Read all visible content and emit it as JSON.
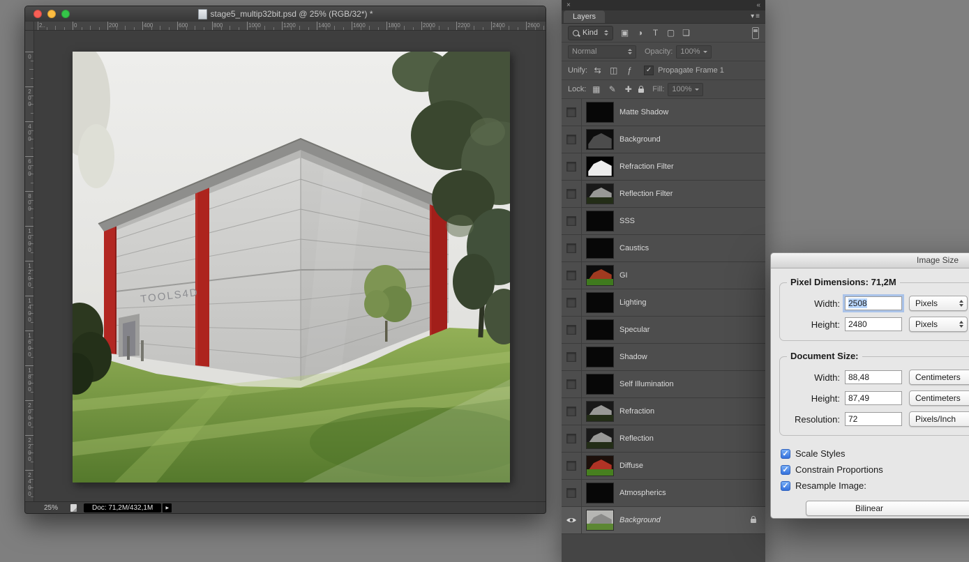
{
  "window": {
    "title": "stage5_multip32bit.psd @ 25% (RGB/32*) *",
    "zoom_level": "25%",
    "doc_info": "Doc: 71,2M/432,1M",
    "sign_text": "TOOLS4D",
    "ruler_top_labels": [
      "2..",
      "0",
      "200",
      "400",
      "600",
      "800",
      "1000",
      "1200",
      "1400",
      "1600",
      "1800",
      "2000",
      "2200",
      "2400",
      "2600"
    ],
    "ruler_left_labels": [
      "0",
      "200",
      "400",
      "600",
      "800",
      "1000",
      "1200",
      "1400",
      "1600",
      "1800",
      "2000",
      "2200",
      "2400"
    ]
  },
  "layers_panel": {
    "tab_label": "Layers",
    "kind_label": "Kind",
    "blend_mode": "Normal",
    "opacity_label": "Opacity:",
    "opacity_value": "100%",
    "unify_label": "Unify:",
    "propagate_label": "Propagate Frame 1",
    "propagate_checked": true,
    "lock_label": "Lock:",
    "fill_label": "Fill:",
    "fill_value": "100%",
    "filter_icons": [
      {
        "name": "pixel-layer-filter-icon",
        "glyph": "▣"
      },
      {
        "name": "adjustment-layer-filter-icon",
        "glyph": "◑"
      },
      {
        "name": "type-layer-filter-icon",
        "glyph": "T"
      },
      {
        "name": "shape-layer-filter-icon",
        "glyph": "▢"
      },
      {
        "name": "smart-object-filter-icon",
        "glyph": "❏"
      }
    ],
    "unify_icons": [
      {
        "name": "unify-position-icon",
        "glyph": "⇆"
      },
      {
        "name": "unify-visibility-icon",
        "glyph": "◫"
      },
      {
        "name": "unify-style-icon",
        "glyph": "ƒ"
      }
    ],
    "lock_icons": [
      {
        "name": "lock-transparency-icon",
        "glyph": "▦"
      },
      {
        "name": "lock-pixels-icon",
        "glyph": "✎"
      },
      {
        "name": "lock-position-icon",
        "glyph": "✚"
      }
    ],
    "layers": [
      {
        "name": "Matte Shadow",
        "thumb": "black",
        "visible": false
      },
      {
        "name": "Background",
        "thumb": "dark",
        "visible": false
      },
      {
        "name": "Refraction Filter",
        "thumb": "white",
        "visible": false
      },
      {
        "name": "Reflection Filter",
        "thumb": "gray",
        "visible": false
      },
      {
        "name": "SSS",
        "thumb": "black",
        "visible": false
      },
      {
        "name": "Caustics",
        "thumb": "black",
        "visible": false
      },
      {
        "name": "GI",
        "thumb": "gi",
        "visible": false
      },
      {
        "name": "Lighting",
        "thumb": "black",
        "visible": false
      },
      {
        "name": "Specular",
        "thumb": "black",
        "visible": false
      },
      {
        "name": "Shadow",
        "thumb": "black",
        "visible": false
      },
      {
        "name": "Self Illumination",
        "thumb": "black",
        "visible": false
      },
      {
        "name": "Refraction",
        "thumb": "gray",
        "visible": false
      },
      {
        "name": "Reflection",
        "thumb": "gray",
        "visible": false
      },
      {
        "name": "Diffuse",
        "thumb": "diffuse",
        "visible": false
      },
      {
        "name": "Atmospherics",
        "thumb": "black",
        "visible": false
      },
      {
        "name": "Background",
        "thumb": "render",
        "visible": true,
        "locked": true,
        "italic": true,
        "selected": true
      }
    ]
  },
  "dialog": {
    "title": "Image Size",
    "pixel_dimensions_label": "Pixel Dimensions:",
    "pixel_dimensions_value": "71,2M",
    "document_size_label": "Document Size:",
    "fields": {
      "pixel_width_label": "Width:",
      "pixel_width_value": "2508",
      "pixel_width_unit": "Pixels",
      "pixel_height_label": "Height:",
      "pixel_height_value": "2480",
      "pixel_height_unit": "Pixels",
      "doc_width_label": "Width:",
      "doc_width_value": "88,48",
      "doc_width_unit": "Centimeters",
      "doc_height_label": "Height:",
      "doc_height_value": "87,49",
      "doc_height_unit": "Centimeters",
      "resolution_label": "Resolution:",
      "resolution_value": "72",
      "resolution_unit": "Pixels/Inch"
    },
    "checkboxes": [
      {
        "label": "Scale Styles",
        "checked": true
      },
      {
        "label": "Constrain Proportions",
        "checked": true
      },
      {
        "label": "Resample Image:",
        "checked": true
      }
    ],
    "resample_method": "Bilinear"
  },
  "icons": {
    "close_dock": "×",
    "collapse_dock": "«",
    "panel_menu_arrow": "▾",
    "panel_menu_lines": "≡",
    "check": "✓",
    "status_arrow": "▶"
  },
  "colors": {
    "selection_highlight": "#b8d6fc",
    "pillar_red": "#b0261f",
    "checkbox_blue": "#3471dd"
  }
}
